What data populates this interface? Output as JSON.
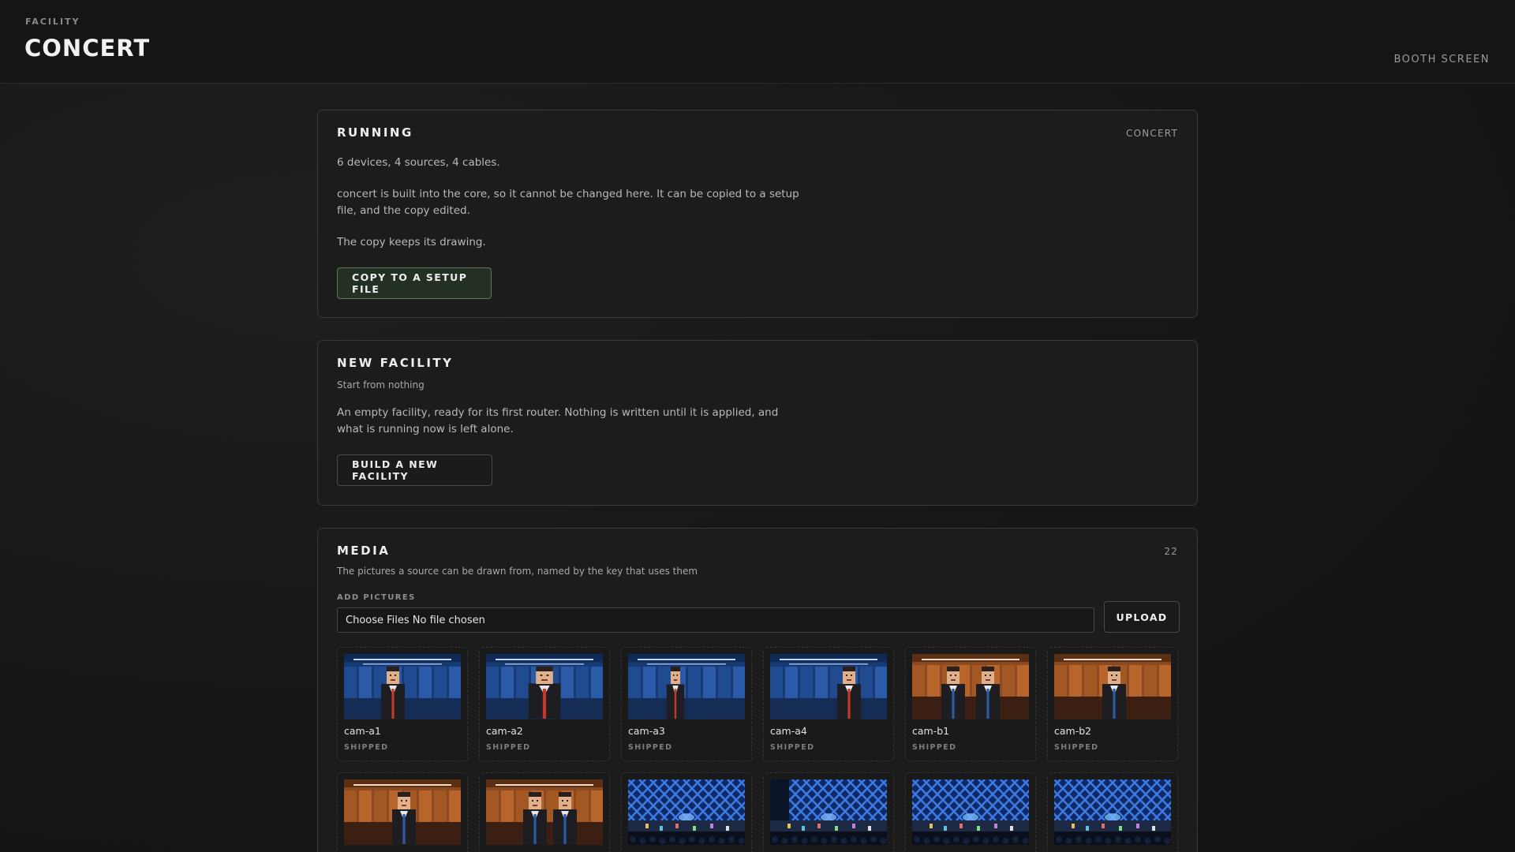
{
  "header": {
    "eyebrow": "FACILITY",
    "title": "CONCERT",
    "booth_link": "BOOTH SCREEN"
  },
  "running": {
    "heading": "RUNNING",
    "tag": "CONCERT",
    "counts": "6 devices, 4 sources, 4 cables.",
    "builtin_note": "concert is built into the core, so it cannot be changed here. It can be copied to a setup file, and the copy edited.",
    "drawing_note": "The copy keeps its drawing.",
    "copy_button": "COPY TO A SETUP FILE"
  },
  "new_facility": {
    "heading": "NEW FACILITY",
    "subtitle": "Start from nothing",
    "description": "An empty facility, ready for its first router. Nothing is written until it is applied, and what is running now is left alone.",
    "build_button": "BUILD A NEW FACILITY"
  },
  "media": {
    "heading": "MEDIA",
    "count": "22",
    "subtitle": "The pictures a source can be drawn from, named by the key that uses them",
    "add_label": "ADD PICTURES",
    "file_input_text": "Choose Files No file chosen",
    "upload_button": "UPLOAD",
    "items": [
      {
        "name": "cam-a1",
        "status": "SHIPPED",
        "scene": "blue-studio"
      },
      {
        "name": "cam-a2",
        "status": "SHIPPED",
        "scene": "blue-studio"
      },
      {
        "name": "cam-a3",
        "status": "SHIPPED",
        "scene": "blue-studio"
      },
      {
        "name": "cam-a4",
        "status": "SHIPPED",
        "scene": "blue-studio"
      },
      {
        "name": "cam-b1",
        "status": "SHIPPED",
        "scene": "orange-studio"
      },
      {
        "name": "cam-b2",
        "status": "SHIPPED",
        "scene": "orange-studio"
      },
      {
        "name": "",
        "status": "",
        "scene": "orange-studio"
      },
      {
        "name": "",
        "status": "",
        "scene": "orange-studio"
      },
      {
        "name": "",
        "status": "",
        "scene": "stage"
      },
      {
        "name": "",
        "status": "",
        "scene": "stage"
      },
      {
        "name": "",
        "status": "",
        "scene": "stage"
      },
      {
        "name": "",
        "status": "",
        "scene": "stage"
      }
    ]
  },
  "colors": {
    "accent_green": "#5d7a55",
    "studio_blue": "#2b4f8c",
    "studio_orange": "#b5622a"
  }
}
